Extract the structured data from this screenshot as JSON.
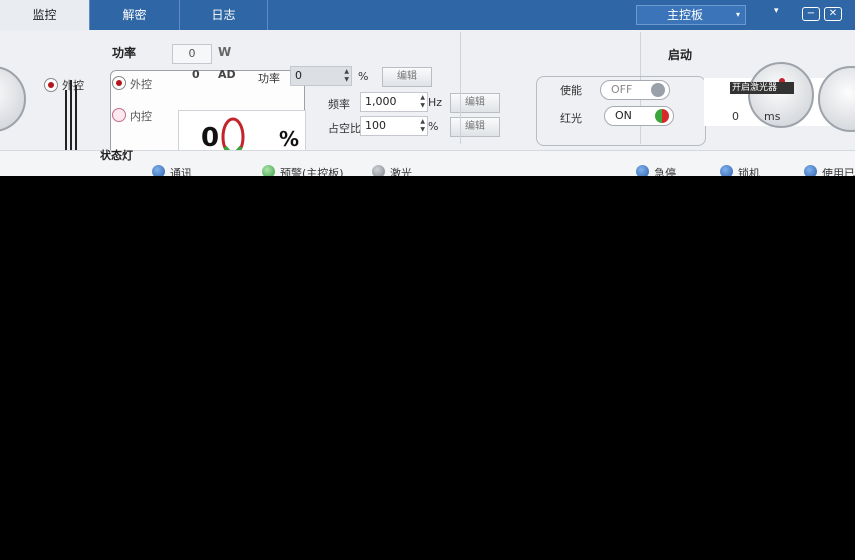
{
  "tabs": [
    {
      "label": "监控",
      "active": true
    },
    {
      "label": "解密",
      "active": false
    },
    {
      "label": "日志",
      "active": false
    }
  ],
  "board_select": {
    "value": "主控板"
  },
  "window_controls": {
    "arrow": "▾",
    "minimize": "−",
    "close": "✕"
  },
  "power": {
    "title": "功率",
    "watt_value": "0",
    "watt_unit": "W",
    "ad_value": "0",
    "ad_unit": "AD",
    "percent_label": "功率",
    "percent_value": "0",
    "percent_unit": "%",
    "edit_label": "编辑"
  },
  "mode": {
    "external_label": "外控",
    "internal_label": "内控",
    "panel_big_value": "0",
    "panel_unit": "%",
    "knob_value_label": "外控",
    "knob_value": "0"
  },
  "frequency": {
    "label": "频率",
    "value": "1,000",
    "unit": "Hz",
    "edit_label": "编辑"
  },
  "duty": {
    "label": "占空比",
    "value": "100",
    "unit": "%",
    "edit_label": "编辑"
  },
  "switches": {
    "laser_label": "使能",
    "laser_state": "OFF",
    "red_label": "红光",
    "red_state": "ON"
  },
  "start": {
    "title": "启动",
    "start_button": "开启激光器",
    "sub_value": "0",
    "sub_unit": "ms"
  },
  "status": {
    "title": "状态灯",
    "items": [
      {
        "label": "通讯",
        "color": "blue"
      },
      {
        "label": "预警(主控板)",
        "color": "green"
      },
      {
        "label": "激光",
        "color": "gray"
      },
      {
        "label": "急停",
        "color": "blue"
      },
      {
        "label": "锁机",
        "color": "blue"
      },
      {
        "label": "使用已",
        "color": "blue"
      }
    ]
  },
  "colors": {
    "topbar": "#2f66a6",
    "panel": "#eef0f3",
    "accent_red": "#b5151c",
    "accent_green": "#3aa53a"
  }
}
